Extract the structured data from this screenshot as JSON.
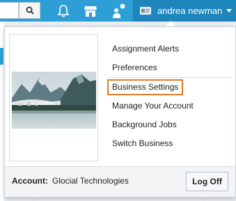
{
  "topbar": {
    "search_placeholder": "",
    "icons": [
      "search-icon",
      "bell-icon",
      "store-icon",
      "user-share-icon"
    ],
    "accent": "#2d9fd6"
  },
  "user_menu": {
    "name": "andrea newman",
    "icon": "card-icon"
  },
  "dropdown": {
    "items": [
      {
        "label": "Assignment Alerts"
      },
      {
        "label": "Preferences"
      },
      {
        "label": "Business Settings",
        "focused": true
      },
      {
        "label": "Manage Your Account"
      },
      {
        "label": "Background Jobs"
      },
      {
        "label": "Switch Business"
      }
    ],
    "account_label": "Account:",
    "account_value": "Glocial Technologies",
    "logoff_label": "Log Off",
    "focus_color": "#e07b24"
  }
}
